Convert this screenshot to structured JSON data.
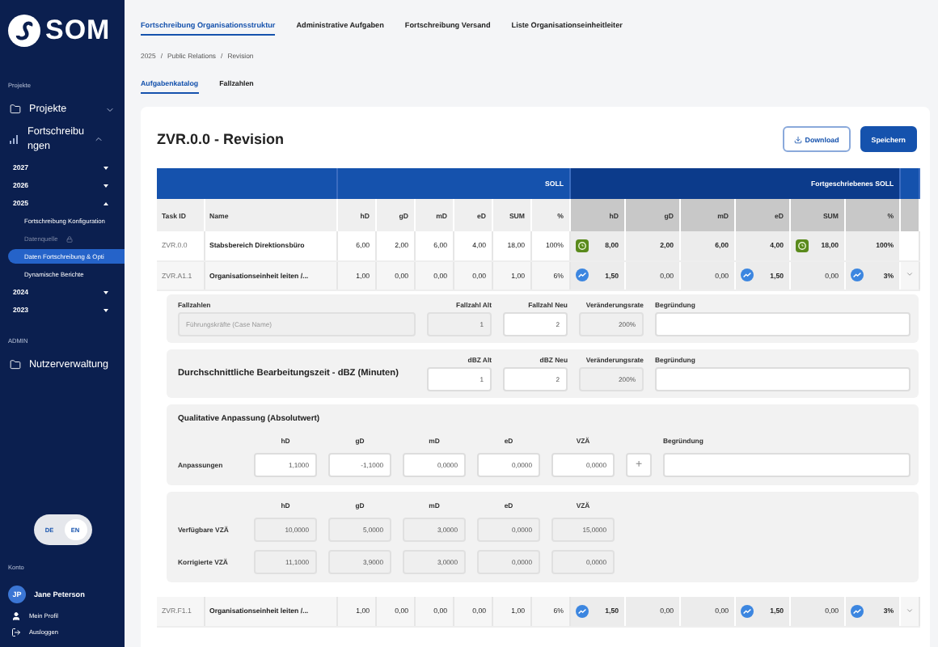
{
  "sidebar": {
    "logo": "SOM",
    "projects_label": "Projekte",
    "nav": [
      {
        "label": "Projekte",
        "kind": "folder",
        "expanded": false
      },
      {
        "label": "Fortschreibungen",
        "kind": "chart",
        "expanded": true,
        "children": [
          {
            "label": "2027",
            "expanded": false
          },
          {
            "label": "2026",
            "expanded": false
          },
          {
            "label": "2025",
            "expanded": true,
            "children": [
              {
                "label": "Fortschreibung Konfiguration",
                "selected": false,
                "disabled": false
              },
              {
                "label": "Datenquelle",
                "selected": false,
                "disabled": true
              },
              {
                "label": "Daten Fortschreibung & Opti",
                "selected": true,
                "disabled": false
              },
              {
                "label": "Dynamische Berichte",
                "selected": false,
                "disabled": false
              }
            ]
          },
          {
            "label": "2024",
            "expanded": false
          },
          {
            "label": "2023",
            "expanded": false
          }
        ]
      }
    ],
    "admin_label": "ADMIN",
    "admin_nav": [
      {
        "label": "Nutzerverwaltung",
        "kind": "folder"
      }
    ],
    "languages": [
      {
        "label": "DE",
        "selected": false
      },
      {
        "label": "EN",
        "selected": true
      }
    ],
    "account_label": "Konto",
    "user": {
      "initials": "JP",
      "name": "Jane Peterson"
    },
    "account_links": [
      {
        "label": "Mein Profil",
        "kind": "profile"
      },
      {
        "label": "Ausloggen",
        "kind": "logout"
      }
    ]
  },
  "top_tabs": [
    {
      "label": "Fortschreibung Organisationsstruktur",
      "selected": true
    },
    {
      "label": "Administrative Aufgaben",
      "selected": false
    },
    {
      "label": "Fortschreibung Versand",
      "selected": false
    },
    {
      "label": "Liste Organisationseinheitleiter",
      "selected": false
    }
  ],
  "breadcrumb": {
    "items": [
      "2025",
      "Public Relations",
      "Revision"
    ],
    "separator": "/"
  },
  "sub_tabs": [
    {
      "label": "Aufgabenkatalog",
      "selected": true
    },
    {
      "label": "Fallzahlen",
      "selected": false
    }
  ],
  "card": {
    "title": "ZVR.0.0 - Revision",
    "actions": [
      {
        "label": "Download",
        "kind": "outline"
      },
      {
        "label": "Speichern",
        "kind": "primary"
      }
    ]
  },
  "table": {
    "groups": {
      "soll": "SOLL",
      "fort": "Fortgeschriebenes SOLL"
    },
    "columns": {
      "id": "Task ID",
      "name": "Name",
      "soll": [
        "hD",
        "gD",
        "mD",
        "eD",
        "SUM",
        "%"
      ],
      "fort": [
        "hD",
        "gD",
        "mD",
        "eD",
        "SUM",
        "%"
      ]
    },
    "rows": [
      {
        "id": "ZVR.0.0",
        "name": "Stabsbereich Direktionsbüro",
        "soll": [
          "6,00",
          "2,00",
          "6,00",
          "4,00",
          "18,00",
          "100%"
        ],
        "fort": [
          {
            "value": "8,00",
            "kind": "ok"
          },
          {
            "value": "2,00",
            "kind": "plain"
          },
          {
            "value": "6,00",
            "kind": "plain"
          },
          {
            "value": "4,00",
            "kind": "plain"
          },
          {
            "value": "18,00",
            "kind": "ok"
          },
          {
            "value": "100%",
            "kind": "plain"
          }
        ]
      },
      {
        "id": "ZVR.A1.1",
        "name": "Organisationseinheit leiten /...",
        "expanded": true,
        "soll": [
          "1,00",
          "0,00",
          "0,00",
          "0,00",
          "1,00",
          "6%"
        ],
        "fort": [
          {
            "value": "1,50",
            "kind": "up"
          },
          {
            "value": "0,00",
            "kind": "plain"
          },
          {
            "value": "0,00",
            "kind": "plain"
          },
          {
            "value": "1,50",
            "kind": "up"
          },
          {
            "value": "0,00",
            "kind": "plain"
          },
          {
            "value": "3%",
            "kind": "up"
          }
        ]
      },
      {
        "id": "ZVR.F1.1",
        "name": "Organisationseinheit leiten /...",
        "expanded": false,
        "soll": [
          "1,00",
          "0,00",
          "0,00",
          "0,00",
          "1,00",
          "6%"
        ],
        "fort": [
          {
            "value": "1,50",
            "kind": "up"
          },
          {
            "value": "0,00",
            "kind": "plain"
          },
          {
            "value": "0,00",
            "kind": "plain"
          },
          {
            "value": "1,50",
            "kind": "up"
          },
          {
            "value": "0,00",
            "kind": "plain"
          },
          {
            "value": "3%",
            "kind": "up"
          }
        ]
      }
    ]
  },
  "detail": {
    "sections": [
      {
        "kind": "rate",
        "title": "Fallzahlen",
        "headers": [
          "Fallzahl Alt",
          "Fallzahl Neu",
          "Veränderungsrate",
          "Begründung"
        ],
        "fields": [
          {
            "placeholder": "Führungskräfte (Case Name)",
            "disabled": true
          },
          {
            "value": "1",
            "disabled": true
          },
          {
            "value": "2",
            "disabled": false
          },
          {
            "value": "200%",
            "disabled": true
          },
          {
            "disabled": false
          }
        ]
      },
      {
        "kind": "rate_inline",
        "title": "Durchschnittliche Bearbeitungszeit - dBZ (Minuten)",
        "headers": [
          "dBZ Alt",
          "dBZ Neu",
          "Veränderungsrate",
          "Begründung"
        ],
        "fields": [
          {
            "value": "1",
            "disabled": false
          },
          {
            "value": "2",
            "disabled": false
          },
          {
            "value": "200%",
            "disabled": true
          },
          {
            "disabled": false
          }
        ]
      },
      {
        "kind": "grid",
        "title": "Qualitative Anpassung (Absolutwert)",
        "headers": [
          "hD",
          "gD",
          "mD",
          "eD",
          "VZÄ"
        ],
        "note_header": "Begründung",
        "rows": [
          {
            "label": "Anpassungen",
            "add": "+",
            "fields": [
              {
                "value": "1,1000",
                "disabled": false
              },
              {
                "value": "-1,1000",
                "disabled": false
              },
              {
                "value": "0,0000",
                "disabled": false
              },
              {
                "value": "0,0000",
                "disabled": false
              },
              {
                "value": "0,0000",
                "disabled": false
              }
            ],
            "note": {
              "disabled": false
            }
          }
        ]
      },
      {
        "kind": "grid",
        "headers": [
          "hD",
          "gD",
          "mD",
          "eD",
          "VZÄ"
        ],
        "rows": [
          {
            "label": "Verfügbare VZÄ",
            "fields": [
              {
                "value": "10,0000",
                "disabled": true
              },
              {
                "value": "5,0000",
                "disabled": true
              },
              {
                "value": "3,0000",
                "disabled": true
              },
              {
                "value": "0,0000",
                "disabled": true
              },
              {
                "value": "15,0000",
                "disabled": true
              }
            ]
          },
          {
            "label": "Korrigierte VZÄ",
            "fields": [
              {
                "value": "11,1000",
                "disabled": true
              },
              {
                "value": "3,9000",
                "disabled": true
              },
              {
                "value": "3,0000",
                "disabled": true
              },
              {
                "value": "0,0000",
                "disabled": true
              },
              {
                "value": "0,0000",
                "disabled": true
              }
            ]
          }
        ]
      }
    ]
  }
}
